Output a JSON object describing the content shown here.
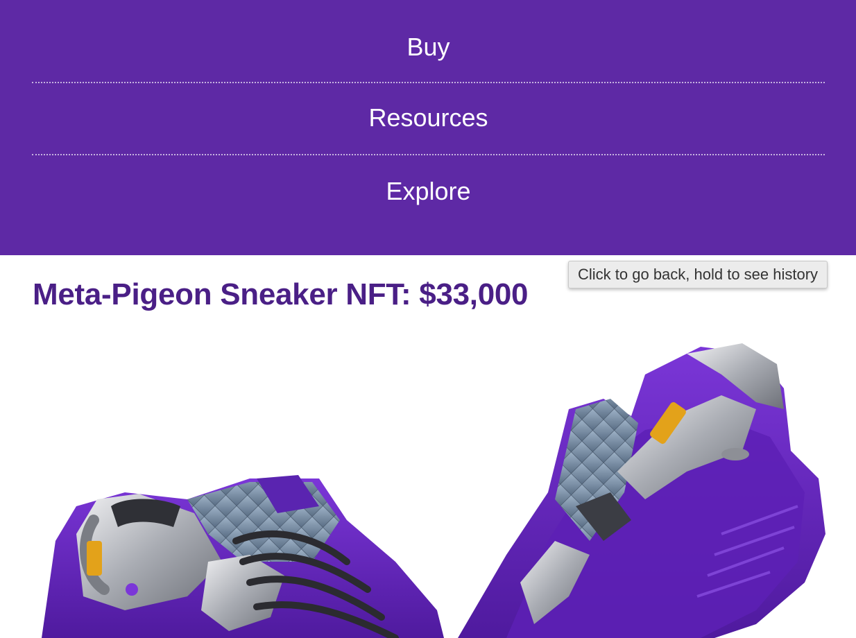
{
  "nav": {
    "items": [
      {
        "label": "Buy"
      },
      {
        "label": "Resources"
      },
      {
        "label": "Explore"
      }
    ]
  },
  "tooltip": {
    "text": "Click to go back, hold to see history"
  },
  "main": {
    "title": "Meta-Pigeon Sneaker NFT: $33,000",
    "image_alt": "Meta-Pigeon sneakers"
  },
  "colors": {
    "nav_bg": "#5e29a5",
    "title": "#4a1f86",
    "sole_purple": "#6a25c9"
  }
}
